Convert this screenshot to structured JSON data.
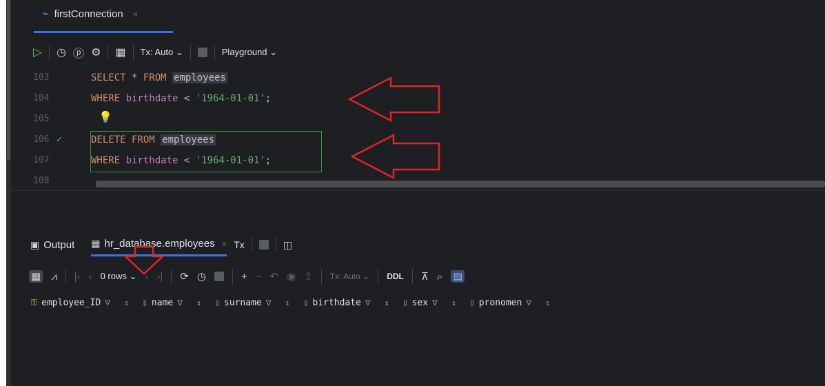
{
  "editor_tab": {
    "title": "firstConnection",
    "close": "×"
  },
  "toolbar": {
    "tx_label": "Tx: Auto",
    "playground_label": "Playground",
    "dropdown_caret": "⌄"
  },
  "code_lines": [
    {
      "num": "103",
      "parts": [
        [
          "kw",
          "SELECT "
        ],
        [
          "op",
          "* "
        ],
        [
          "kw",
          "FROM "
        ],
        [
          "tbl",
          "employees"
        ]
      ]
    },
    {
      "num": "104",
      "parts": [
        [
          "kw",
          "WHERE "
        ],
        [
          "id",
          "birthdate"
        ],
        [
          "op",
          " < "
        ],
        [
          "str",
          "'1964-01-01'"
        ],
        [
          "op",
          ";"
        ]
      ]
    },
    {
      "num": "105",
      "parts": []
    },
    {
      "num": "106",
      "parts": [
        [
          "kw",
          "DELETE FROM "
        ],
        [
          "tbl",
          "employees"
        ]
      ],
      "status": "✓"
    },
    {
      "num": "107",
      "parts": [
        [
          "kw",
          "WHERE "
        ],
        [
          "id",
          "birthdate"
        ],
        [
          "op",
          " < "
        ],
        [
          "str",
          "'1964-01-01'"
        ],
        [
          "op",
          ";"
        ]
      ]
    },
    {
      "num": "108",
      "parts": []
    }
  ],
  "results": {
    "tabs": {
      "output_label": "Output",
      "table_label": "hr_database.employees",
      "close": "×",
      "tx_label": "Tx"
    },
    "rows_label": "0 rows",
    "tx_auto_label": "Tx: Auto",
    "ddl_label": "DDL",
    "columns": [
      "employee_ID",
      "name",
      "surname",
      "birthdate",
      "sex",
      "pronomen"
    ]
  },
  "colors": {
    "keyword": "#cf8e6d",
    "identifier": "#c77dbb",
    "string": "#6aab73",
    "annotation": "#e0242a"
  }
}
